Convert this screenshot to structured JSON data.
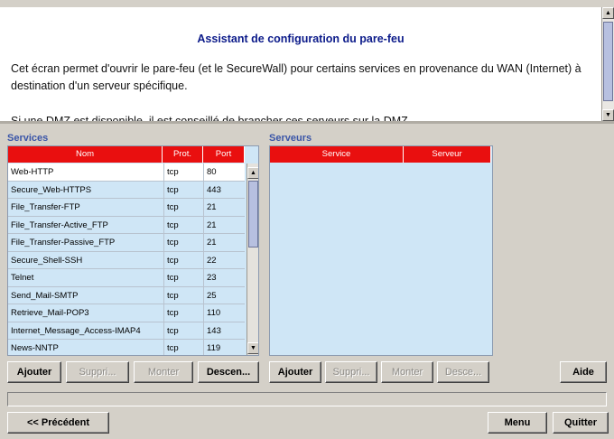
{
  "header": {
    "title": "Assistant de configuration du pare-feu",
    "paragraph1": "Cet écran permet d'ouvrir le pare-feu (et le SecureWall) pour certains services en provenance du WAN (Internet) à destination d'un serveur spécifique.",
    "paragraph2": "Si une DMZ est disponible, il est conseillé de brancher ces serveurs sur la DMZ."
  },
  "services": {
    "label": "Services",
    "columns": {
      "name": "Nom",
      "proto": "Prot.",
      "port": "Port"
    },
    "rows": [
      {
        "name": "Web-HTTP",
        "proto": "tcp",
        "port": "80"
      },
      {
        "name": "Secure_Web-HTTPS",
        "proto": "tcp",
        "port": "443"
      },
      {
        "name": "File_Transfer-FTP",
        "proto": "tcp",
        "port": "21"
      },
      {
        "name": "File_Transfer-Active_FTP",
        "proto": "tcp",
        "port": "21"
      },
      {
        "name": "File_Transfer-Passive_FTP",
        "proto": "tcp",
        "port": "21"
      },
      {
        "name": "Secure_Shell-SSH",
        "proto": "tcp",
        "port": "22"
      },
      {
        "name": "Telnet",
        "proto": "tcp",
        "port": "23"
      },
      {
        "name": "Send_Mail-SMTP",
        "proto": "tcp",
        "port": "25"
      },
      {
        "name": "Retrieve_Mail-POP3",
        "proto": "tcp",
        "port": "110"
      },
      {
        "name": "Internet_Message_Access-IMAP4",
        "proto": "tcp",
        "port": "143"
      },
      {
        "name": "News-NNTP",
        "proto": "tcp",
        "port": "119"
      }
    ],
    "buttons": {
      "add": "Ajouter",
      "delete": "Suppri...",
      "up": "Monter",
      "down": "Descen..."
    }
  },
  "servers": {
    "label": "Serveurs",
    "columns": {
      "service": "Service",
      "server": "Serveur"
    },
    "buttons": {
      "add": "Ajouter",
      "delete": "Suppri...",
      "up": "Monter",
      "down": "Desce..."
    }
  },
  "footer": {
    "help": "Aide",
    "previous": "<< Précédent",
    "menu": "Menu",
    "quit": "Quitter"
  },
  "colors": {
    "header_red": "#e90f0f",
    "panel_blue": "#cfe6f6",
    "title_blue": "#0c1b8a",
    "label_blue": "#3a55a8"
  },
  "icons": {
    "scroll_up": "triangle-up",
    "scroll_down": "triangle-down"
  }
}
